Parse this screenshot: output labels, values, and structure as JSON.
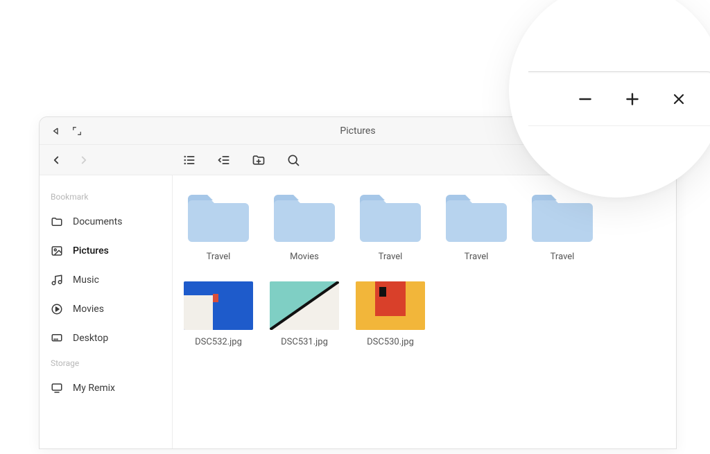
{
  "window": {
    "title": "Pictures"
  },
  "sidebar": {
    "sections": [
      {
        "label": "Bookmark",
        "items": [
          {
            "icon": "folder-icon",
            "label": "Documents",
            "active": false
          },
          {
            "icon": "picture-icon",
            "label": "Pictures",
            "active": true
          },
          {
            "icon": "music-icon",
            "label": "Music",
            "active": false
          },
          {
            "icon": "play-icon",
            "label": "Movies",
            "active": false
          },
          {
            "icon": "desktop-icon",
            "label": "Desktop",
            "active": false
          }
        ]
      },
      {
        "label": "Storage",
        "items": [
          {
            "icon": "monitor-icon",
            "label": "My Remix",
            "active": false
          }
        ]
      }
    ]
  },
  "content": {
    "folders": [
      {
        "label": "Travel"
      },
      {
        "label": "Movies"
      },
      {
        "label": "Travel"
      },
      {
        "label": "Travel"
      },
      {
        "label": "Travel"
      }
    ],
    "images": [
      {
        "label": "DSC532.jpg",
        "style": "a"
      },
      {
        "label": "DSC531.jpg",
        "style": "b"
      },
      {
        "label": "DSC530.jpg",
        "style": "c"
      }
    ]
  },
  "zoom": {
    "buttons": [
      "minimize",
      "maximize",
      "close"
    ]
  }
}
